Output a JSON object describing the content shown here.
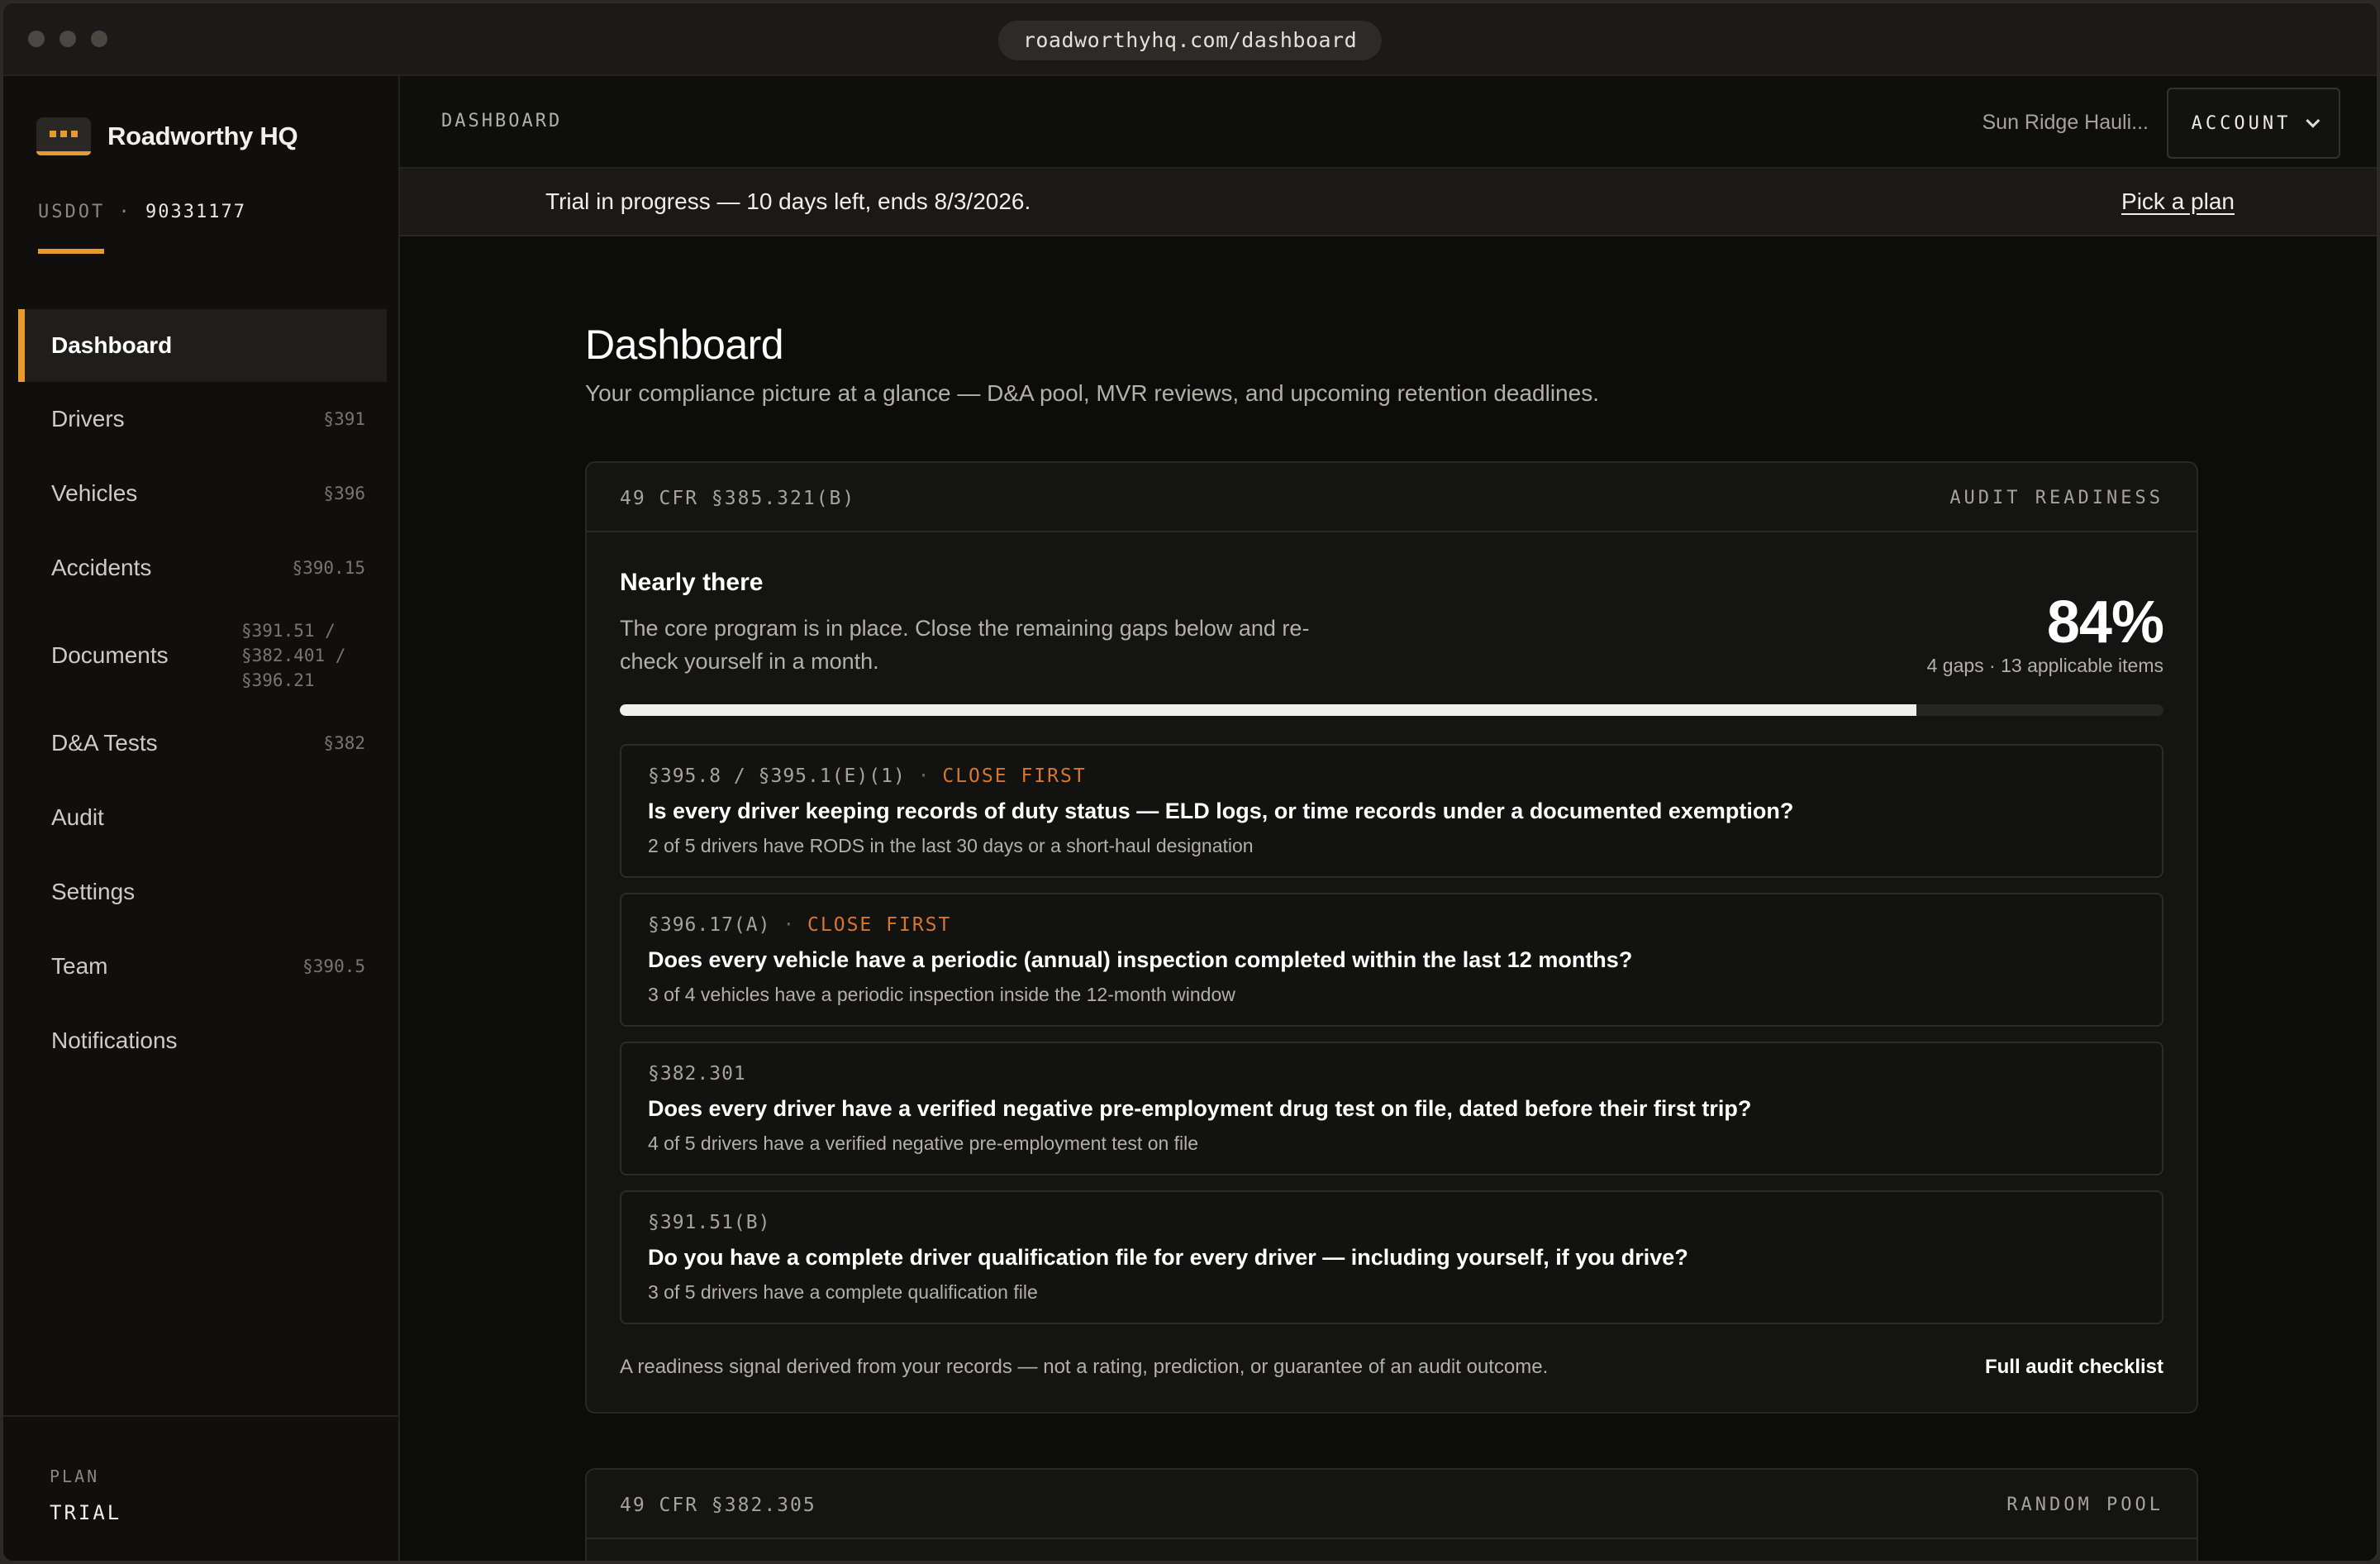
{
  "browser": {
    "url": "roadworthyhq.com/dashboard"
  },
  "sidebar": {
    "brand": "Roadworthy HQ",
    "usdot_label": "USDOT",
    "usdot_sep": "·",
    "usdot_number": "90331177",
    "items": [
      {
        "label": "Dashboard",
        "ref": "",
        "active": true
      },
      {
        "label": "Drivers",
        "ref": "§391"
      },
      {
        "label": "Vehicles",
        "ref": "§396"
      },
      {
        "label": "Accidents",
        "ref": "§390.15"
      },
      {
        "label": "Documents",
        "ref": "§391.51 / §382.401 / §396.21"
      },
      {
        "label": "D&A Tests",
        "ref": "§382"
      },
      {
        "label": "Audit",
        "ref": ""
      },
      {
        "label": "Settings",
        "ref": ""
      },
      {
        "label": "Team",
        "ref": "§390.5"
      },
      {
        "label": "Notifications",
        "ref": ""
      }
    ],
    "plan_label": "PLAN",
    "plan_value": "TRIAL"
  },
  "topbar": {
    "crumb": "DASHBOARD",
    "org": "Sun Ridge Hauli...",
    "account_label": "ACCOUNT"
  },
  "trial": {
    "text": "Trial in progress — 10 days left, ends 8/3/2026.",
    "link": "Pick a plan"
  },
  "page": {
    "title": "Dashboard",
    "subtitle": "Your compliance picture at a glance — D&A pool, MVR reviews, and upcoming retention deadlines."
  },
  "readiness": {
    "code": "49 CFR §385.321(B)",
    "tag": "AUDIT READINESS",
    "status_title": "Nearly there",
    "status_desc": "The core program is in place. Close the remaining gaps below and re-check yourself in a month.",
    "percent_text": "84%",
    "percent": 0.84,
    "meta": "4 gaps · 13 applicable items",
    "gaps": [
      {
        "code": "§395.8 / §395.1(E)(1)",
        "flag": "CLOSE FIRST",
        "question": "Is every driver keeping records of duty status — ELD logs, or time records under a documented exemption?",
        "detail": "2 of 5 drivers have RODS in the last 30 days or a short-haul designation"
      },
      {
        "code": "§396.17(A)",
        "flag": "CLOSE FIRST",
        "question": "Does every vehicle have a periodic (annual) inspection completed within the last 12 months?",
        "detail": "3 of 4 vehicles have a periodic inspection inside the 12-month window"
      },
      {
        "code": "§382.301",
        "flag": "",
        "question": "Does every driver have a verified negative pre-employment drug test on file, dated before their first trip?",
        "detail": "4 of 5 drivers have a verified negative pre-employment test on file"
      },
      {
        "code": "§391.51(B)",
        "flag": "",
        "question": "Do you have a complete driver qualification file for every driver — including yourself, if you drive?",
        "detail": "3 of 5 drivers have a complete qualification file"
      }
    ],
    "footnote": "A readiness signal derived from your records — not a rating, prediction, or guarantee of an audit outcome.",
    "footlink": "Full audit checklist"
  },
  "random_pool": {
    "code": "49 CFR §382.305",
    "tag": "RANDOM POOL"
  },
  "colors": {
    "accent": "#e79a2e",
    "flag": "#d8762f",
    "background": "#0c0c0b"
  }
}
